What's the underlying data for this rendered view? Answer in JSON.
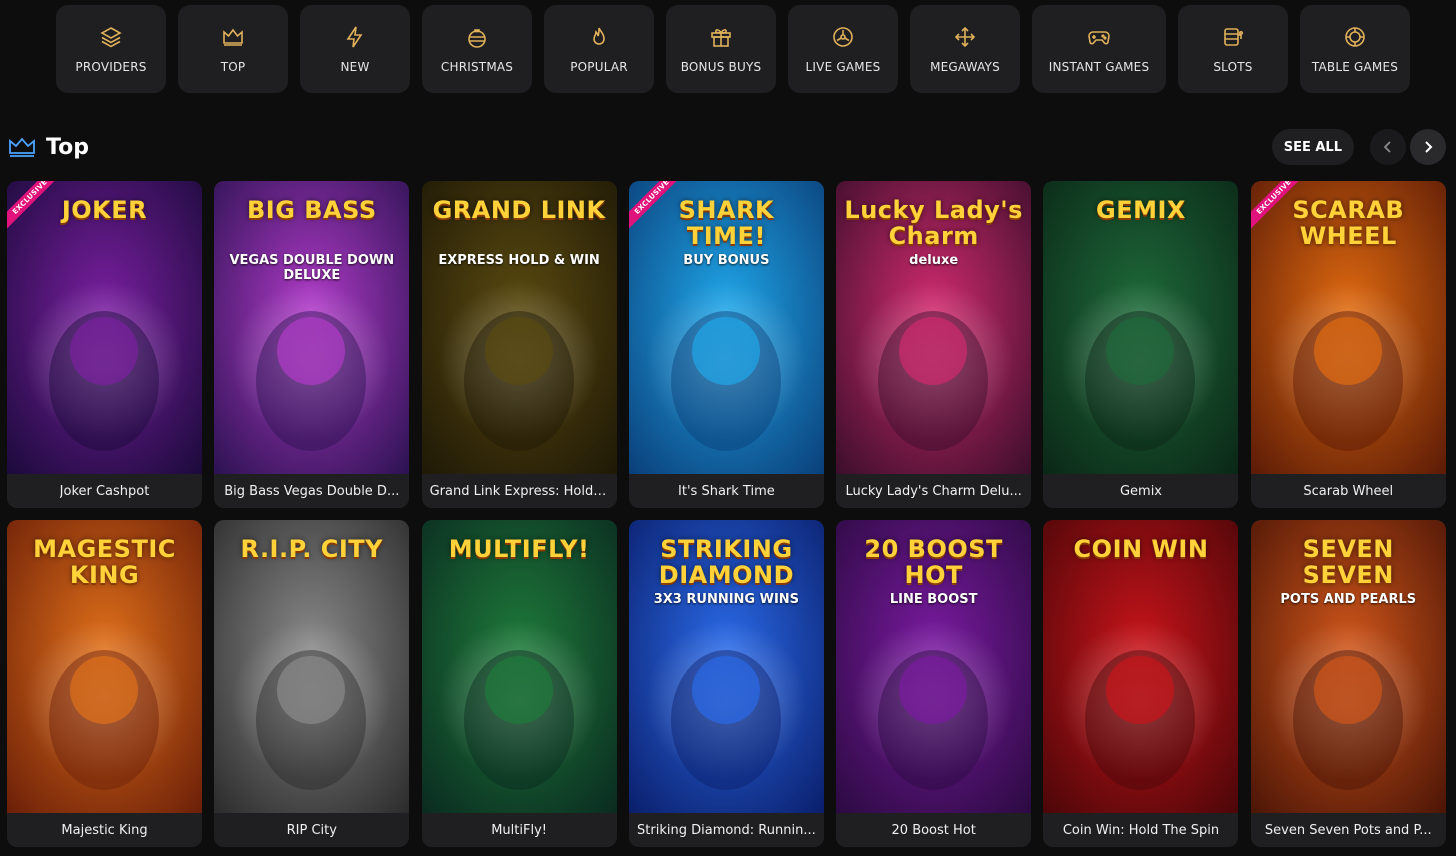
{
  "categories": [
    {
      "label": "PROVIDERS",
      "icon": "layers-icon"
    },
    {
      "label": "TOP",
      "icon": "crown-icon"
    },
    {
      "label": "NEW",
      "icon": "lightning-icon"
    },
    {
      "label": "CHRISTMAS",
      "icon": "ornament-icon"
    },
    {
      "label": "POPULAR",
      "icon": "flame-icon"
    },
    {
      "label": "BONUS BUYS",
      "icon": "gift-icon"
    },
    {
      "label": "LIVE GAMES",
      "icon": "live-icon"
    },
    {
      "label": "MEGAWAYS",
      "icon": "arrows-icon"
    },
    {
      "label": "INSTANT GAMES",
      "icon": "gamepad-icon"
    },
    {
      "label": "SLOTS",
      "icon": "slot-machine-icon"
    },
    {
      "label": "TABLE GAMES",
      "icon": "chip-icon"
    }
  ],
  "section": {
    "title": "Top",
    "icon": "crown-icon",
    "see_all": "SEE ALL",
    "accent": "#4aa3ff"
  },
  "games": [
    {
      "name": "Joker Cashpot",
      "art_title": "JOKER",
      "art_sub": "",
      "exclusive": true,
      "bg1": "#7a1fa0",
      "bg2": "#1a0a3a",
      "exclusive_label": "EXCLUSIVE"
    },
    {
      "name": "Big Bass Vegas Double D...",
      "art_title": "BIG BASS",
      "art_sub": "VEGAS DOUBLE DOWN DELUXE",
      "exclusive": false,
      "bg1": "#b03ac8",
      "bg2": "#2a1250"
    },
    {
      "name": "Grand Link Express: Hold ...",
      "art_title": "GRAND LINK",
      "art_sub": "EXPRESS HOLD & WIN",
      "exclusive": false,
      "bg1": "#5a4a10",
      "bg2": "#1e1806"
    },
    {
      "name": "It's Shark Time",
      "art_title": "SHARK TIME!",
      "art_sub": "BUY BONUS",
      "exclusive": true,
      "bg1": "#1fa6e8",
      "bg2": "#0a3e78",
      "exclusive_label": "EXCLUSIVE"
    },
    {
      "name": "Lucky Lady's Charm Delu...",
      "art_title": "Lucky Lady's Charm",
      "art_sub": "deluxe",
      "exclusive": false,
      "bg1": "#d02a6e",
      "bg2": "#3a0e2a"
    },
    {
      "name": "Gemix",
      "art_title": "GEMIX",
      "art_sub": "",
      "exclusive": false,
      "bg1": "#1e6a3a",
      "bg2": "#0a2616"
    },
    {
      "name": "Scarab Wheel",
      "art_title": "SCARAB WHEEL",
      "art_sub": "",
      "exclusive": true,
      "bg1": "#e06a10",
      "bg2": "#5a1a06",
      "exclusive_label": "EXCLUSIVE"
    },
    {
      "name": "Majestic King",
      "art_title": "MAGESTIC KING",
      "art_sub": "",
      "exclusive": false,
      "bg1": "#e0701a",
      "bg2": "#6a1e08"
    },
    {
      "name": "RIP City",
      "art_title": "R.I.P. CITY",
      "art_sub": "",
      "exclusive": false,
      "bg1": "#8a8a8a",
      "bg2": "#2a2a2a"
    },
    {
      "name": "MultiFly!",
      "art_title": "MULTIFLY!",
      "art_sub": "",
      "exclusive": false,
      "bg1": "#1e7a3a",
      "bg2": "#0a2a20"
    },
    {
      "name": "Striking Diamond: Runnin...",
      "art_title": "STRIKING DIAMOND",
      "art_sub": "3X3 RUNNING WINS",
      "exclusive": false,
      "bg1": "#2a6ae8",
      "bg2": "#0a1e6a"
    },
    {
      "name": "20 Boost Hot",
      "art_title": "20 BOOST HOT",
      "art_sub": "LINE BOOST",
      "exclusive": false,
      "bg1": "#7a1aa0",
      "bg2": "#2a0a40"
    },
    {
      "name": "Coin Win: Hold The Spin",
      "art_title": "COIN WIN",
      "art_sub": "",
      "exclusive": false,
      "bg1": "#c8141a",
      "bg2": "#4a0608"
    },
    {
      "name": "Seven Seven Pots and P...",
      "art_title": "SEVEN SEVEN",
      "art_sub": "POTS AND PEARLS",
      "exclusive": false,
      "bg1": "#d0561a",
      "bg2": "#4a1406"
    }
  ],
  "colors": {
    "background": "#0d0d0e",
    "tile": "#1f1f21",
    "icon_gold": "#e0b15a"
  }
}
